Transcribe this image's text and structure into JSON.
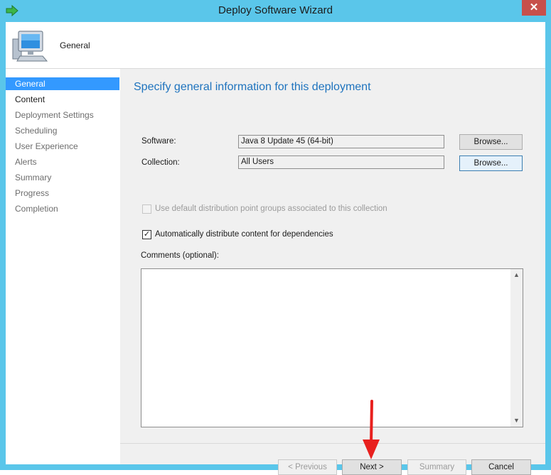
{
  "window": {
    "title": "Deploy Software Wizard",
    "close_label": "✕"
  },
  "header": {
    "title": "General"
  },
  "nav": {
    "items": [
      {
        "label": "General"
      },
      {
        "label": "Content"
      },
      {
        "label": "Deployment Settings"
      },
      {
        "label": "Scheduling"
      },
      {
        "label": "User Experience"
      },
      {
        "label": "Alerts"
      },
      {
        "label": "Summary"
      },
      {
        "label": "Progress"
      },
      {
        "label": "Completion"
      }
    ]
  },
  "main": {
    "heading": "Specify general information for this deployment",
    "software": {
      "label": "Software:",
      "value": "Java 8 Update 45 (64-bit)",
      "browse_label": "Browse..."
    },
    "collection": {
      "label": "Collection:",
      "value": "All Users",
      "browse_label": "Browse..."
    },
    "use_default_dp": {
      "label": "Use default distribution point groups associated to this collection",
      "checked": false,
      "enabled": false
    },
    "auto_distribute": {
      "label": "Automatically distribute content for dependencies",
      "checked": true,
      "check_glyph": "✓"
    },
    "comments": {
      "label": "Comments (optional):",
      "value": ""
    },
    "scroll_up_glyph": "▲",
    "scroll_down_glyph": "▼"
  },
  "footer": {
    "previous_label": "< Previous",
    "next_label": "Next >",
    "summary_label": "Summary",
    "cancel_label": "Cancel"
  },
  "colors": {
    "frame": "#5ac6ea",
    "accent": "#1e73be",
    "nav_selected": "#3399ff",
    "close": "#c7504b",
    "annotation_arrow": "#e8201e"
  },
  "icons": {
    "title": "green-arrow-icon",
    "header": "computer-icon",
    "annotation": "red-arrow-icon"
  }
}
